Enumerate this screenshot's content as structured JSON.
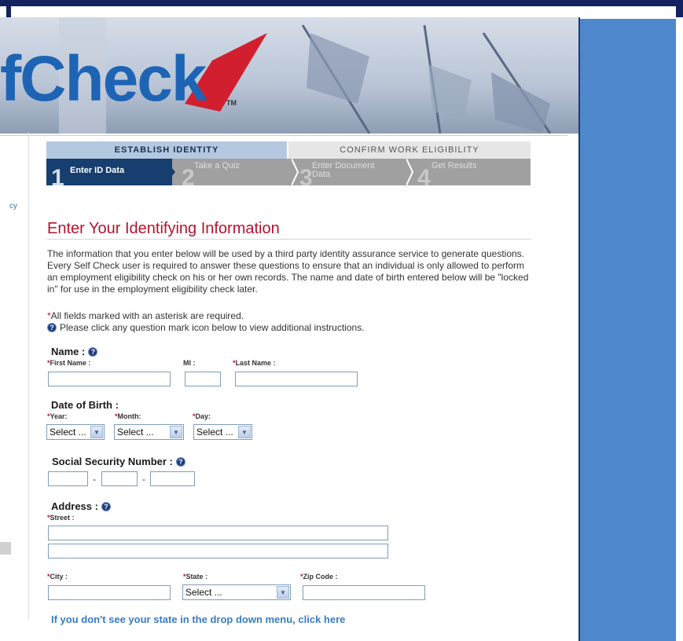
{
  "banner": {
    "logo_text": "fCheck",
    "trademark": "TM"
  },
  "left_edge": {
    "fragment": "cy"
  },
  "progress": {
    "phase_1": "ESTABLISH IDENTITY",
    "phase_2": "CONFIRM WORK ELIGIBILITY",
    "steps": [
      {
        "number": "1",
        "label": "Enter ID Data"
      },
      {
        "number": "2",
        "label": "Take a Quiz"
      },
      {
        "number": "3",
        "label_line1": "Enter Document",
        "label_line2": "Data"
      },
      {
        "number": "4",
        "label": "Get Results"
      }
    ]
  },
  "page": {
    "title": "Enter Your Identifying Information",
    "intro": "The information that you enter below will be used by a third party identity assurance service to generate questions. Every Self Check user is required to answer these questions to ensure that an individual is only allowed to perform an employment eligibility check on his or her own records. The name and date of birth entered below will be \"locked in\" for use in the employment eligibility check later.",
    "required_asterisk": "*",
    "required_note": "All fields marked with an asterisk are required.",
    "help_note": "Please click any question mark icon below to view additional instructions."
  },
  "name_section": {
    "heading": "Name :",
    "first_label": "First Name :",
    "mi_label": "MI :",
    "last_label": "Last Name :",
    "first_value": "",
    "mi_value": "",
    "last_value": ""
  },
  "dob_section": {
    "heading": "Date of Birth :",
    "year_label": "Year:",
    "month_label": "Month:",
    "day_label": "Day:",
    "year_value": "Select ...",
    "month_value": "Select ...",
    "day_value": "Select ..."
  },
  "ssn_section": {
    "heading": "Social Security Number :",
    "separator": "-"
  },
  "address_section": {
    "heading": "Address :",
    "street_label": "Street :",
    "city_label": "City :",
    "state_label": "State :",
    "zip_label": "Zip Code :",
    "state_value": "Select ...",
    "state_link": "If you don't see your state in the drop down menu, click here"
  },
  "icons": {
    "help": "question-mark-icon",
    "dropdown": "chevron-down-icon"
  },
  "colors": {
    "title_red": "#b3132c",
    "required_red": "#c8102e",
    "active_step": "#163e6e",
    "inactive_step": "#a0a0a0",
    "link_blue": "#3a7cc0",
    "right_panel": "#4f87cc"
  }
}
